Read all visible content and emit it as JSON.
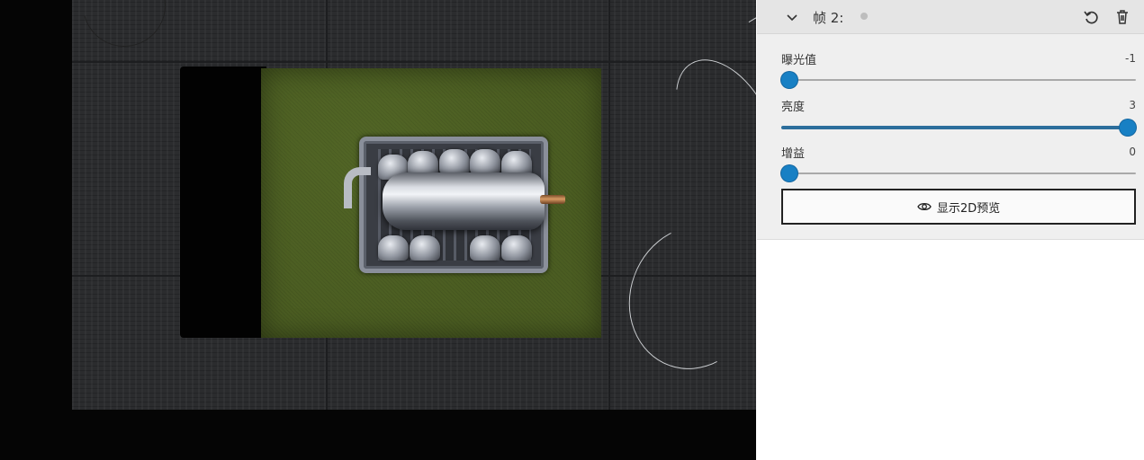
{
  "panel": {
    "title": "帧 2:",
    "icons": {
      "collapse": "chevron-down-icon",
      "reset": "reset-icon",
      "delete": "trash-icon",
      "preview": "eye-icon"
    },
    "params": [
      {
        "label": "曝光值",
        "value": "-1",
        "level": 0.0
      },
      {
        "label": "亮度",
        "value": "3",
        "level": 1.0
      },
      {
        "label": "增益",
        "value": "0",
        "level": 0.0
      }
    ],
    "preview_button_label": "显示2D预览"
  },
  "colors": {
    "accent": "#1880c4",
    "slider_fill": "#2c6e9c",
    "panel_bg": "#efefef",
    "header_bg": "#e5e5e5"
  }
}
